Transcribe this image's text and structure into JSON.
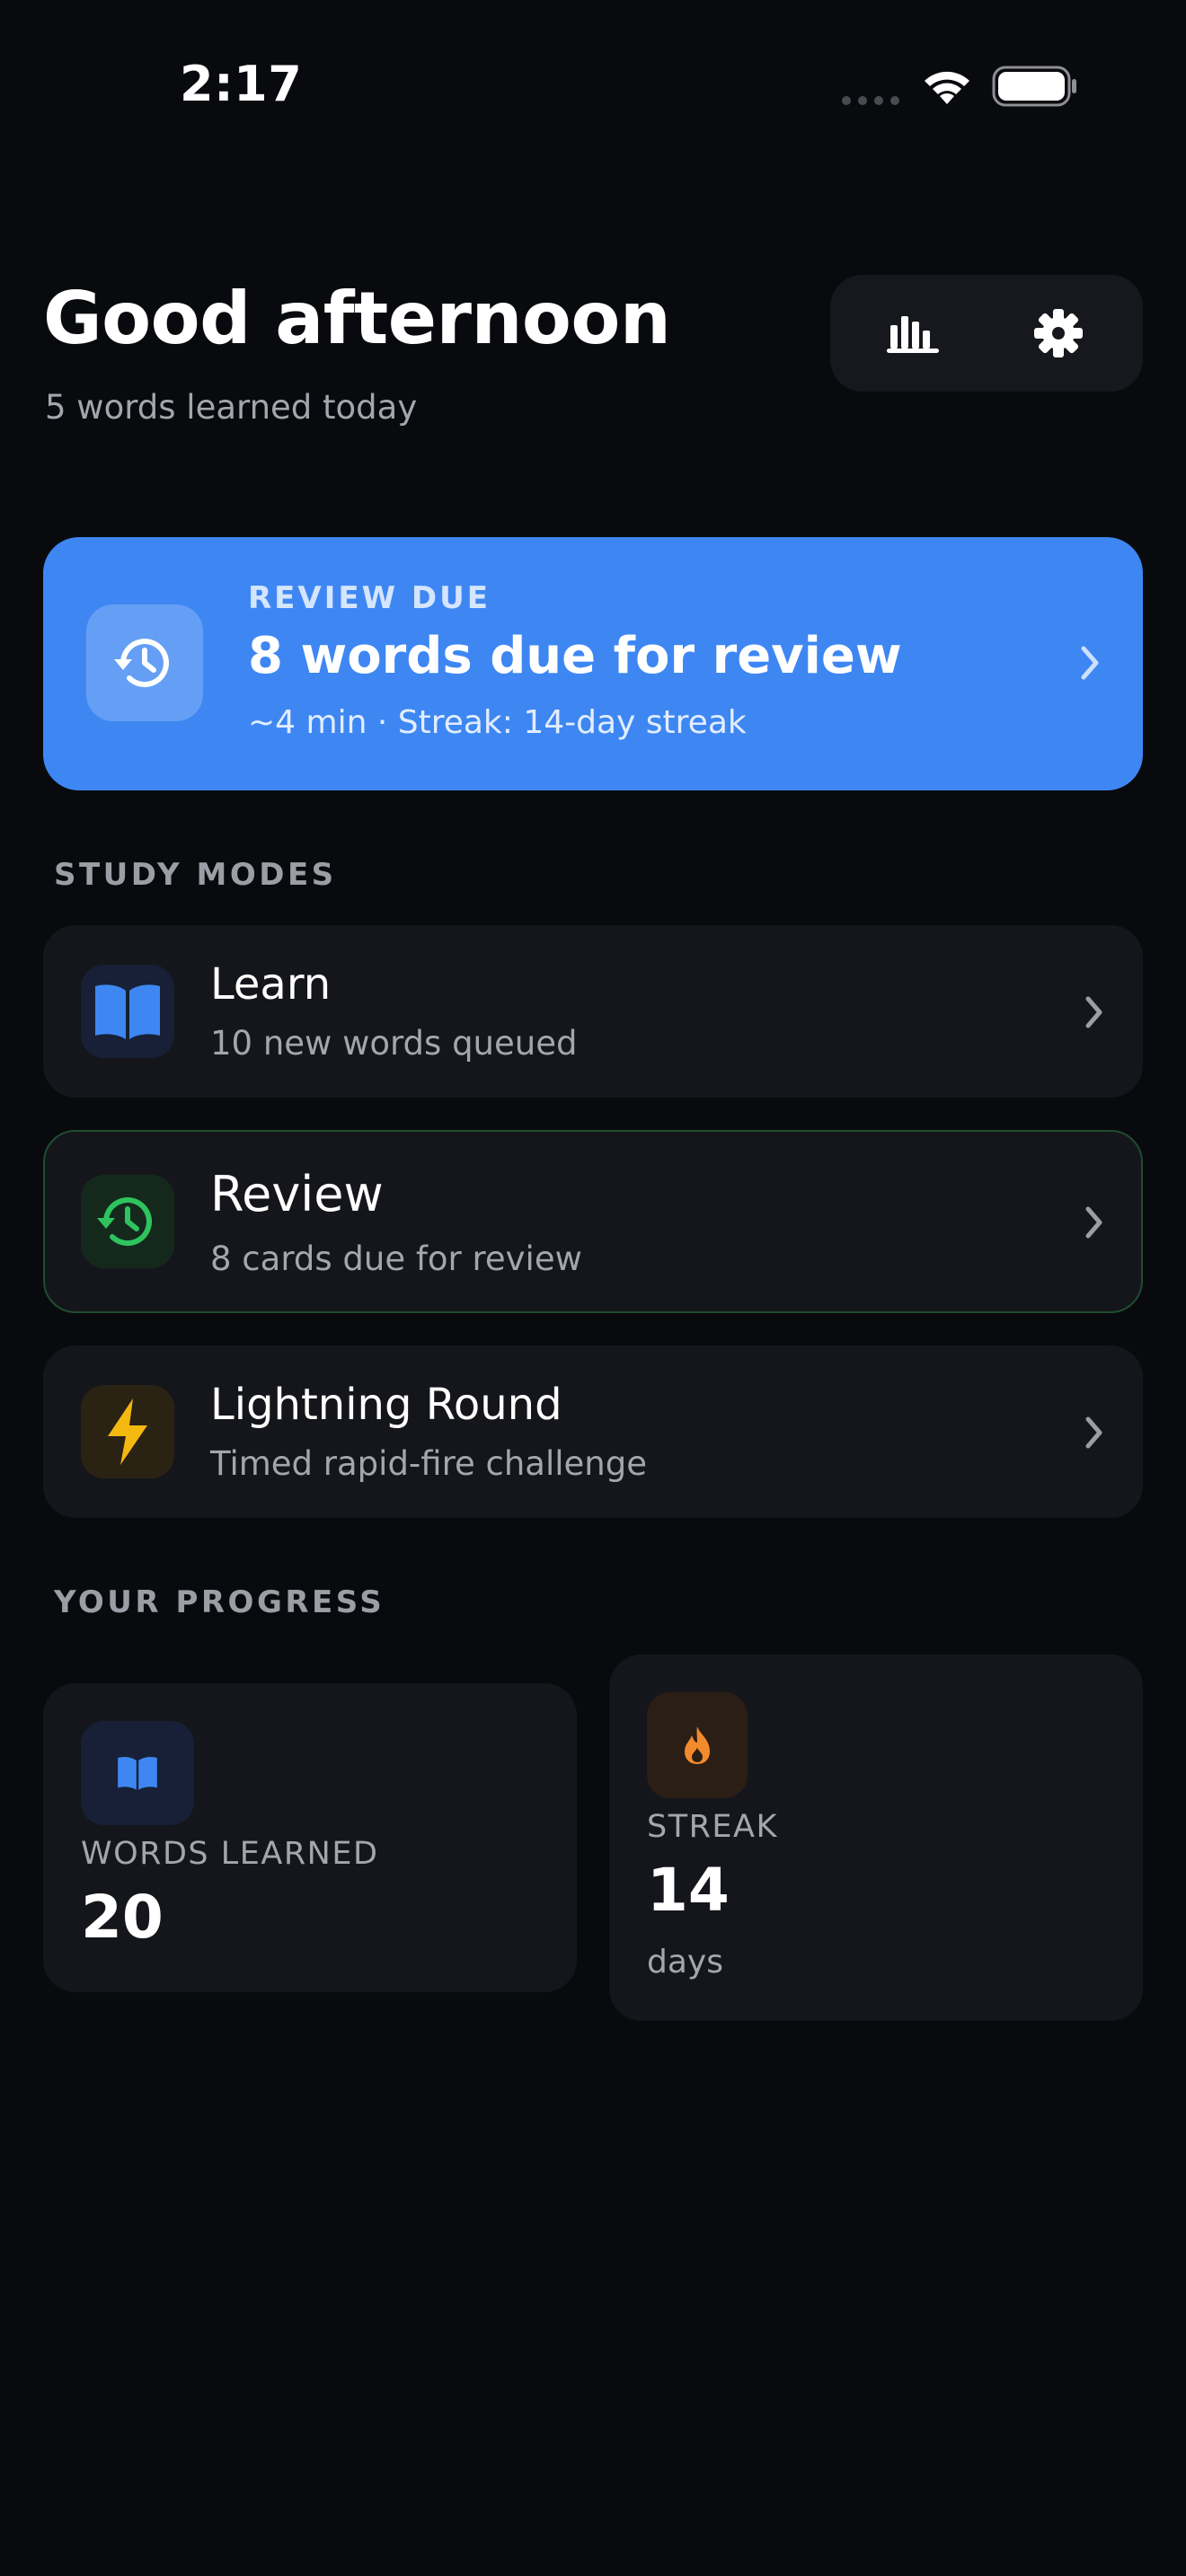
{
  "status_bar": {
    "time": "2:17"
  },
  "header": {
    "greeting": "Good afternoon",
    "subtitle": "5 words learned today"
  },
  "review_banner": {
    "eyebrow": "REVIEW DUE",
    "title": "8 words due for review",
    "subtitle": "~4 min · Streak: 14-day streak",
    "color": "#3e87f3"
  },
  "study_modes": {
    "section_title": "STUDY MODES",
    "items": [
      {
        "title": "Learn",
        "subtitle": "10 new words queued",
        "icon": "book-icon",
        "accent": "#3e87f3"
      },
      {
        "title": "Review",
        "subtitle": "8 cards due for review",
        "icon": "history-icon",
        "accent": "#2fc35f"
      },
      {
        "title": "Lightning Round",
        "subtitle": "Timed rapid-fire challenge",
        "icon": "lightning-icon",
        "accent": "#f5b811"
      }
    ]
  },
  "progress": {
    "section_title": "YOUR PROGRESS",
    "words_learned": {
      "label": "WORDS LEARNED",
      "value": "20",
      "icon": "book-icon"
    },
    "streak": {
      "label": "STREAK",
      "value": "14",
      "unit": "days",
      "icon": "flame-icon",
      "accent": "#f38b2c"
    }
  }
}
